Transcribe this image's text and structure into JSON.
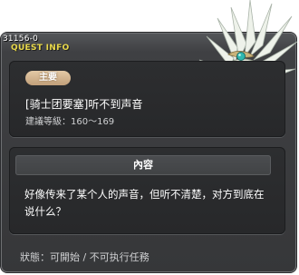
{
  "header": {
    "quest_id": "31156-0",
    "section_title": "QUEST INFO"
  },
  "quest": {
    "type_badge": "主要",
    "name": "[骑士团要塞]听不到声音",
    "level_requirement": "建議等級：160～169"
  },
  "content": {
    "header": "內容",
    "text": "好像传来了某个人的声音，但听不清楚，对方到底在说什么？"
  },
  "status": {
    "text": "狀態：可開始 / 不可执行任務"
  },
  "colors": {
    "title_yellow": "#e8d84a",
    "badge_tan": "#c2a07a",
    "panel_dark": "#27282a"
  },
  "icons": {
    "quest_npc": "white-feathered-creature-portrait"
  }
}
